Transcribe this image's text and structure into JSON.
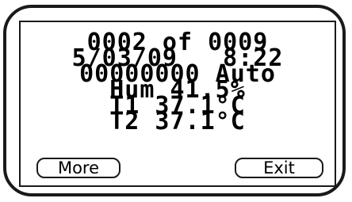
{
  "display": {
    "record": "0002 of 0009",
    "datetime": "5/03/09   8:22",
    "id_mode": "00000000 Auto",
    "humidity": "Hum 41.5%",
    "temp1": "T1 37.1°C",
    "temp2": "T2 37.1°C"
  },
  "buttons": {
    "more_label": "More",
    "exit_label": "Exit"
  }
}
